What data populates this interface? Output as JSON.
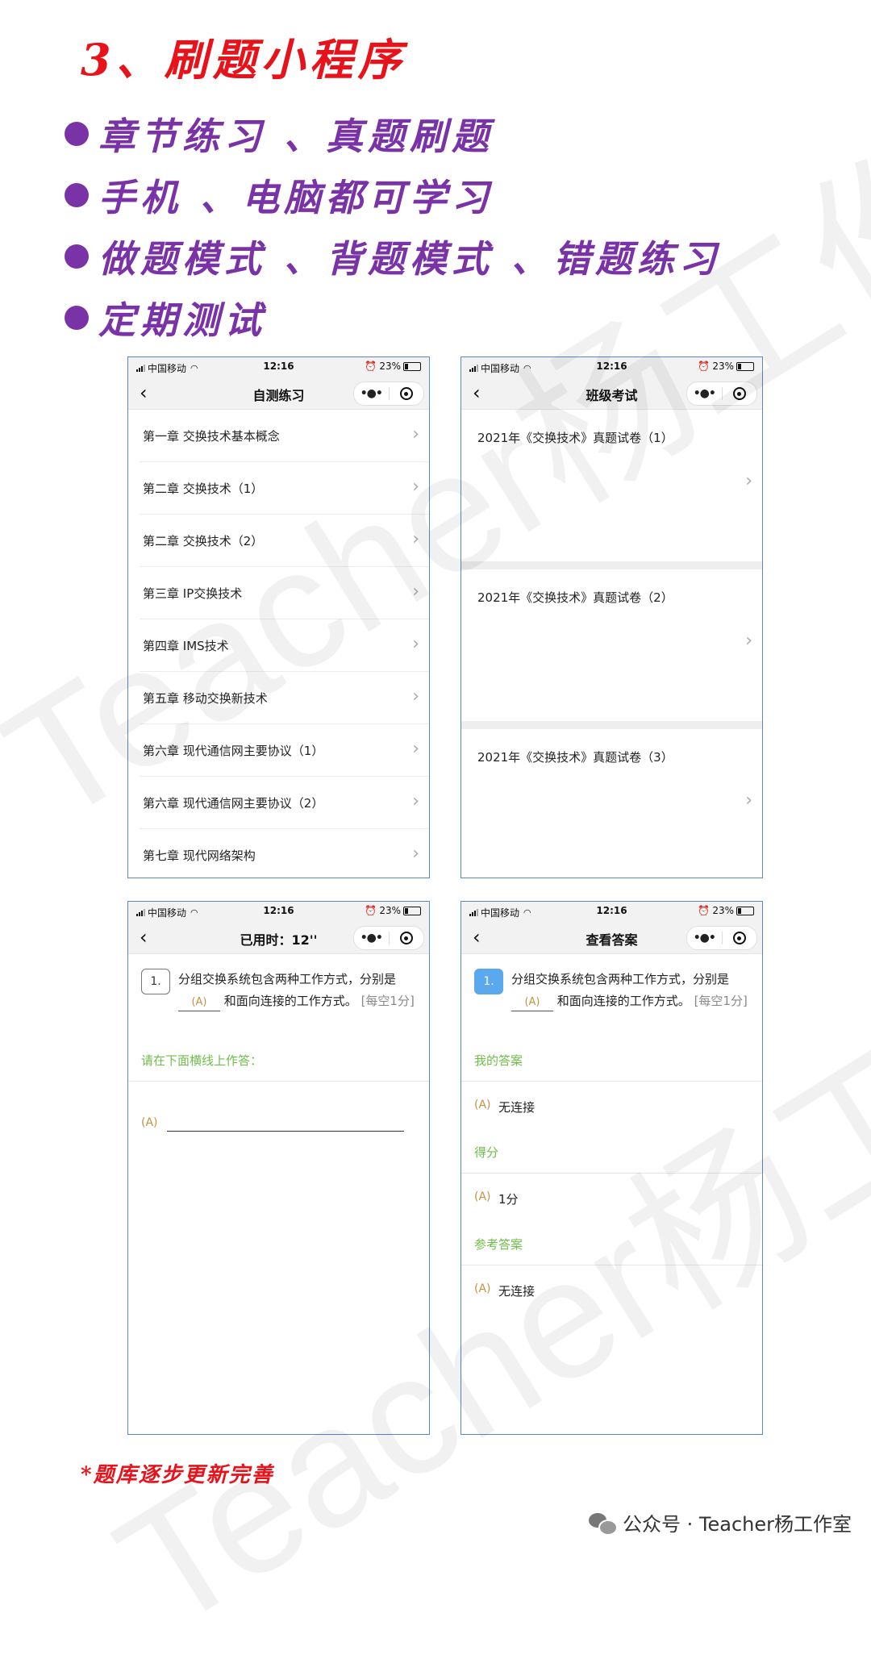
{
  "header": {
    "title": "3、刷题小程序",
    "bullets": [
      "章节练习 、真题刷题",
      "手机 、电脑都可学习",
      "做题模式 、背题模式 、错题练习",
      "定期测试"
    ]
  },
  "watermark": "Teacher杨工作室",
  "status_bar": {
    "carrier": "中国移动",
    "time": "12:16",
    "battery": "23%"
  },
  "phone1": {
    "title": "自测练习",
    "items": [
      "第一章 交换技术基本概念",
      "第二章 交换技术（1）",
      "第二章 交换技术（2）",
      "第三章 IP交换技术",
      "第四章 IMS技术",
      "第五章 移动交换新技术",
      "第六章 现代通信网主要协议（1）",
      "第六章 现代通信网主要协议（2）",
      "第七章 现代网络架构"
    ]
  },
  "phone2": {
    "title": "班级考试",
    "items": [
      "2021年《交换技术》真题试卷（1）",
      "2021年《交换技术》真题试卷（2）",
      "2021年《交换技术》真题试卷（3）"
    ]
  },
  "question": {
    "number": "1.",
    "text_part1": "分组交换系统包含两种工作方式，分别是",
    "blank_label": "(A)",
    "text_part2": "和面向连接的工作方式。",
    "note": "[每空1分]"
  },
  "phone3": {
    "title": "已用时：12''",
    "instruction": "请在下面横线上作答：",
    "answer_label": "(A)"
  },
  "phone4": {
    "title": "查看答案",
    "my_answer_header": "我的答案",
    "my_answer": "无连接",
    "score_header": "得分",
    "score": "1分",
    "reference_header": "参考答案",
    "reference_answer": "无连接",
    "answer_label": "(A)"
  },
  "footer": {
    "note": "*题库逐步更新完善",
    "brand": "公众号 · Teacher杨工作室"
  }
}
